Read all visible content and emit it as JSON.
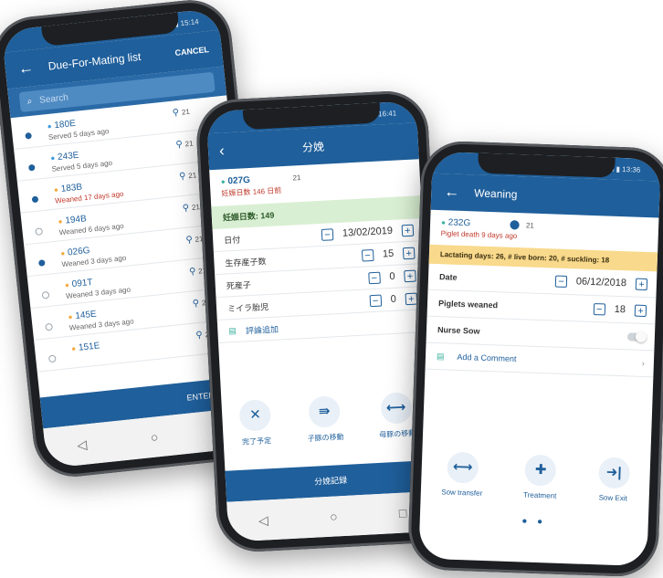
{
  "phone1": {
    "status": "◀ ▼ ▯ 43% ▮ 15:14",
    "title": "Due-For-Mating list",
    "cancel": "CANCEL",
    "search_placeholder": "Search",
    "rows": [
      {
        "id": "180E",
        "sub": "Served 5 days ago",
        "pen": "21",
        "color": "#3b9be0",
        "filled": true,
        "red": false
      },
      {
        "id": "243E",
        "sub": "Served 5 days ago",
        "pen": "21",
        "color": "#3b9be0",
        "filled": true,
        "red": false
      },
      {
        "id": "183B",
        "sub": "Weaned 17 days ago",
        "pen": "21",
        "color": "#f2a93b",
        "filled": true,
        "red": true
      },
      {
        "id": "194B",
        "sub": "Weaned 6 days ago",
        "pen": "21",
        "color": "#f2a93b",
        "filled": false,
        "red": false
      },
      {
        "id": "026G",
        "sub": "Weaned 3 days ago",
        "pen": "21",
        "color": "#f2a93b",
        "filled": true,
        "red": false
      },
      {
        "id": "091T",
        "sub": "Weaned 3 days ago",
        "pen": "21",
        "color": "#f2a93b",
        "filled": false,
        "red": false
      },
      {
        "id": "145E",
        "sub": "Weaned 3 days ago",
        "pen": "21",
        "color": "#f2a93b",
        "filled": false,
        "red": false
      },
      {
        "id": "151E",
        "sub": "",
        "pen": "21",
        "color": "#f2a93b",
        "filled": false,
        "red": false
      }
    ],
    "enter_button": "ENTER 4 SOW",
    "nav": [
      "◁",
      "○",
      "□"
    ]
  },
  "phone2": {
    "status": "16:41",
    "title": "分娩",
    "sow_id": "027G",
    "sow_pen": "21",
    "sow_sub": "妊娠日数 146 日前",
    "banner": "妊娠日数: 149",
    "fields": [
      {
        "label": "日付",
        "value": "13/02/2019"
      },
      {
        "label": "生存産子数",
        "value": "15"
      },
      {
        "label": "死産子",
        "value": "0"
      },
      {
        "label": "ミイラ胎児",
        "value": "0"
      }
    ],
    "comment": "評論追加",
    "actions": [
      {
        "icon": "✕",
        "label": "完了予定"
      },
      {
        "icon": "⇛",
        "label": "子豚の移動"
      },
      {
        "icon": "⟷",
        "label": "母豚の移動"
      }
    ],
    "pager": "● ●",
    "bottom": "分娩記録",
    "nav": [
      "◁",
      "○",
      "□"
    ]
  },
  "phone3": {
    "status": "◀ ▼ ▯ 44% ▮ 13:36",
    "title": "Weaning",
    "sow_id": "232G",
    "sow_pen": "21",
    "sow_sub": "Piglet death 9 days ago",
    "banner": "Lactating days: 26, # live born: 20, # suckling: 18",
    "date_label": "Date",
    "date_value": "06/12/2018",
    "piglets_label": "Piglets weaned",
    "piglets_value": "18",
    "nurse_label": "Nurse Sow",
    "comment": "Add a Comment",
    "actions": [
      {
        "icon": "⟷",
        "label": "Sow transfer"
      },
      {
        "icon": "✚",
        "label": "Treatment"
      },
      {
        "icon": "➜|",
        "label": "Sow Exit"
      }
    ],
    "pager": "● ●"
  },
  "colors": {
    "primary": "#1f5f9b",
    "green_banner": "#d9efd3",
    "yellow_banner": "#f9d98b",
    "red_text": "#c0392b"
  }
}
